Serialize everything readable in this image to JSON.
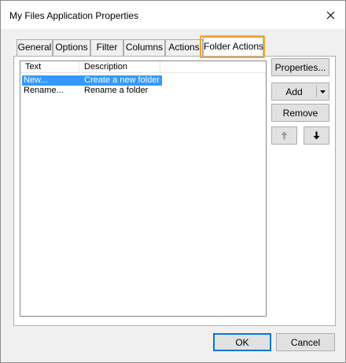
{
  "window": {
    "title": "My Files Application Properties"
  },
  "tabs": [
    {
      "label": "General"
    },
    {
      "label": "Options"
    },
    {
      "label": "Filter"
    },
    {
      "label": "Columns"
    },
    {
      "label": "Actions"
    },
    {
      "label": "Folder Actions",
      "active": true
    }
  ],
  "list": {
    "columns": [
      {
        "label": "Text"
      },
      {
        "label": "Description"
      }
    ],
    "rows": [
      {
        "text": "New...",
        "description": "Create a new folder",
        "selected": true
      },
      {
        "text": "Rename...",
        "description": "Rename a folder",
        "selected": false
      }
    ]
  },
  "side_buttons": {
    "properties": "Properties...",
    "add": "Add",
    "remove": "Remove"
  },
  "footer": {
    "ok": "OK",
    "cancel": "Cancel"
  },
  "colors": {
    "selection": "#3399ff",
    "highlight": "#f4a82b"
  }
}
